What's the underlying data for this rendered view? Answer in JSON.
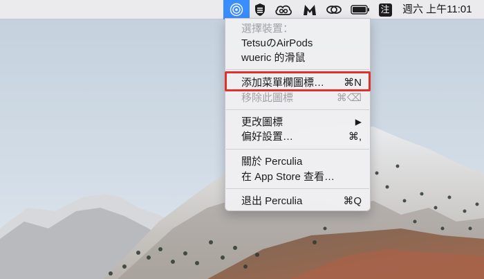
{
  "menubar": {
    "clock": "週六 上午11:01",
    "icons": [
      "perculia-icon",
      "shield-app-icon",
      "creative-cloud-icon",
      "malwarebytes-icon",
      "chain-link-icon",
      "battery-icon",
      "input-method-icon"
    ],
    "input_method_label": "注",
    "accent_color": "#3a8dff"
  },
  "menu": {
    "section_header": "選擇裝置：",
    "devices": [
      {
        "label": "TetsuのAirPods"
      },
      {
        "label": "wueric 的滑鼠"
      }
    ],
    "add_icon": {
      "label": "添加菜單欄圖標…",
      "shortcut": "⌘N"
    },
    "remove_icon": {
      "label": "移除此圖標",
      "shortcut": "⌘⌫"
    },
    "change_icon": {
      "label": "更改圖標",
      "submenu_arrow": "▶"
    },
    "preferences": {
      "label": "偏好設置…",
      "shortcut": "⌘,"
    },
    "about": {
      "label": "關於 Perculia"
    },
    "app_store": {
      "label": "在 App Store 查看…"
    },
    "quit": {
      "label": "退出 Perculia",
      "shortcut": "⌘Q"
    },
    "highlight_color": "#e0302a"
  }
}
